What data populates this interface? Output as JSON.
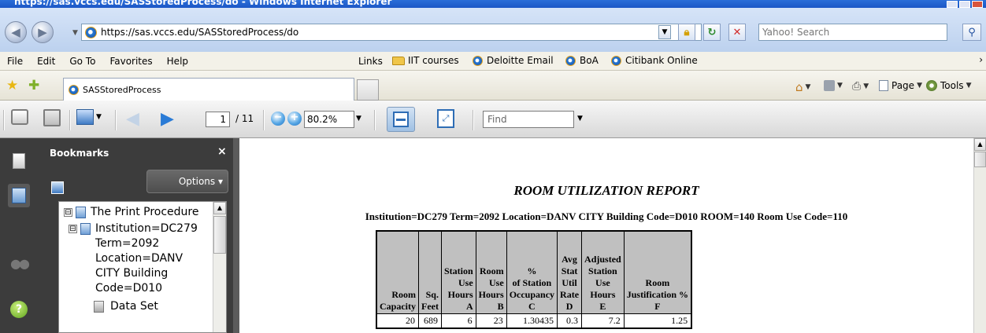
{
  "window": {
    "title": "https://sas.vccs.edu/SASStoredProcess/do - Windows Internet Explorer"
  },
  "address_bar": {
    "url": "https://sas.vccs.edu/SASStoredProcess/do",
    "search_placeholder": "Yahoo! Search"
  },
  "menu": {
    "items": [
      "File",
      "Edit",
      "Go To",
      "Favorites",
      "Help"
    ],
    "links_label": "Links",
    "links": [
      {
        "label": "IIT courses",
        "icon": "folder-icon"
      },
      {
        "label": "Deloitte Email",
        "icon": "ie-icon"
      },
      {
        "label": "BoA",
        "icon": "ie-icon"
      },
      {
        "label": "Citibank Online",
        "icon": "ie-icon"
      }
    ],
    "overflow": "›"
  },
  "tabs": {
    "active_label": "SASStoredProcess",
    "page_label": "Page",
    "tools_label": "Tools",
    "overflow": "›"
  },
  "pdf_toolbar": {
    "current_page": "1",
    "total_pages": "/ 11",
    "zoom": "80.2%",
    "find_placeholder": "Find",
    "zoom_out": "−",
    "zoom_in": "+"
  },
  "bookmarks": {
    "title": "Bookmarks",
    "close": "×",
    "options_label": "Options ▾",
    "tree": [
      {
        "label": "The Print Procedure",
        "expander": "⊟"
      },
      {
        "label_lines": [
          "Institution=DC279",
          "Term=2092",
          "Location=DANV",
          "CITY Building",
          "Code=D010"
        ],
        "expander": "⊟"
      },
      {
        "label": "Data Set"
      }
    ]
  },
  "report": {
    "title": "ROOM UTILIZATION REPORT",
    "subtitle": "Institution=DC279 Term=2092 Location=DANV CITY Building Code=D010 ROOM=140 Room Use Code=110",
    "columns": [
      [
        "Room",
        "Capacity"
      ],
      [
        "Sq.",
        "Feet"
      ],
      [
        "Station",
        "Use",
        "Hours",
        "A"
      ],
      [
        "Room",
        "Use",
        "Hours",
        "B"
      ],
      [
        "%",
        "of Station",
        "Occupancy",
        "C"
      ],
      [
        "Avg",
        "Stat",
        "Util",
        "Rate",
        "D"
      ],
      [
        "Adjusted",
        "Station",
        "Use",
        "Hours",
        "E"
      ],
      [
        "Room",
        "Justification %",
        "F"
      ]
    ],
    "rows": [
      [
        "20",
        "689",
        "6",
        "23",
        "1.30435",
        "0.3",
        "7.2",
        "1.25"
      ]
    ]
  },
  "icons": {
    "back": "back-arrow-icon",
    "forward": "forward-arrow-icon",
    "lock": "lock-icon",
    "refresh": "refresh-icon",
    "stop": "stop-icon",
    "search": "search-icon",
    "home": "home-icon",
    "feeds": "feeds-icon",
    "print": "printer-icon",
    "page": "page-icon",
    "tools": "gear-icon",
    "help": "help-icon"
  },
  "colors": {
    "titlebar": "#1c57c6",
    "header_bg": "#c0c0c0",
    "sidebar_bg": "#3c3c3c",
    "accent": "#2a7bd6"
  }
}
